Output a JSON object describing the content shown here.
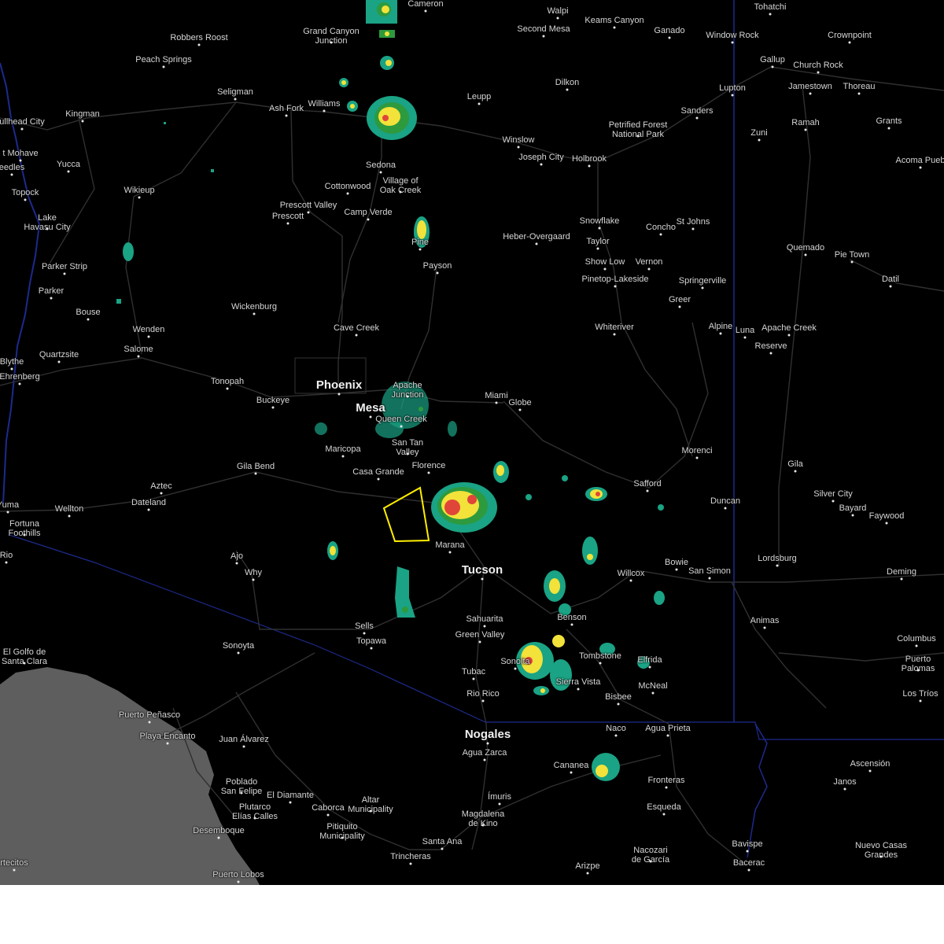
{
  "map": {
    "colors": {
      "background": "#000000",
      "mexico_land": "#050505",
      "ocean": "#5e5e5e",
      "road": "#2f2f2f",
      "border": "#1d2a8c",
      "warning_polygon": "#ffee00",
      "radar_light": "#1aa384",
      "radar_mid": "#2e9a3e",
      "radar_heavy": "#f2e23a",
      "radar_intense": "#e0453a"
    },
    "cities": [
      {
        "id": "cameron",
        "label": "Cameron"
      },
      {
        "id": "walpi",
        "label": "Walpi"
      },
      {
        "id": "second-mesa",
        "label": "Second Mesa"
      },
      {
        "id": "keams-canyon",
        "label": "Keams Canyon"
      },
      {
        "id": "tohatchi",
        "label": "Tohatchi"
      },
      {
        "id": "ganado",
        "label": "Ganado"
      },
      {
        "id": "window-rock",
        "label": "Window Rock"
      },
      {
        "id": "crownpoint",
        "label": "Crownpoint"
      },
      {
        "id": "robbers-roost",
        "label": "Robbers Roost"
      },
      {
        "id": "grand-canyon-junction",
        "label": "Grand Canyon Junction"
      },
      {
        "id": "peach-springs",
        "label": "Peach Springs"
      },
      {
        "id": "gallup",
        "label": "Gallup"
      },
      {
        "id": "church-rock",
        "label": "Church Rock"
      },
      {
        "id": "dilkon",
        "label": "Dilkon"
      },
      {
        "id": "lupton",
        "label": "Lupton"
      },
      {
        "id": "jamestown",
        "label": "Jamestown"
      },
      {
        "id": "thoreau",
        "label": "Thoreau"
      },
      {
        "id": "seligman",
        "label": "Seligman"
      },
      {
        "id": "bullhead-city",
        "label": "ullhead City"
      },
      {
        "id": "kingman",
        "label": "Kingman"
      },
      {
        "id": "williams",
        "label": "Williams"
      },
      {
        "id": "ash-fork",
        "label": "Ash Fork"
      },
      {
        "id": "leupp",
        "label": "Leupp"
      },
      {
        "id": "sanders",
        "label": "Sanders"
      },
      {
        "id": "grants",
        "label": "Grants"
      },
      {
        "id": "ramah",
        "label": "Ramah"
      },
      {
        "id": "fort-mohave",
        "label": "t Mohave"
      },
      {
        "id": "petrified-forest",
        "label": "Petrified Forest National Park"
      },
      {
        "id": "zuni",
        "label": "Zuni"
      },
      {
        "id": "winslow",
        "label": "Winslow"
      },
      {
        "id": "needles",
        "label": "eedles"
      },
      {
        "id": "yucca",
        "label": "Yucca"
      },
      {
        "id": "joseph-city",
        "label": "Joseph City"
      },
      {
        "id": "holbrook",
        "label": "Holbrook"
      },
      {
        "id": "acoma-pueblo",
        "label": "Acoma Pueb"
      },
      {
        "id": "sedona",
        "label": "Sedona"
      },
      {
        "id": "village-of-oak-creek",
        "label": "Village of Oak Creek"
      },
      {
        "id": "cottonwood",
        "label": "Cottonwood"
      },
      {
        "id": "wikieup",
        "label": "Wikieup"
      },
      {
        "id": "topock",
        "label": "Topock"
      },
      {
        "id": "prescott-valley",
        "label": "Prescott Valley"
      },
      {
        "id": "prescott",
        "label": "Prescott"
      },
      {
        "id": "camp-verde",
        "label": "Camp Verde"
      },
      {
        "id": "snowflake",
        "label": "Snowflake"
      },
      {
        "id": "lake-havasu-city",
        "label": "Lake Havasu City"
      },
      {
        "id": "concho",
        "label": "Concho"
      },
      {
        "id": "st-johns",
        "label": "St Johns"
      },
      {
        "id": "heber-overgaard",
        "label": "Heber-Overgaard"
      },
      {
        "id": "pine",
        "label": "Pine"
      },
      {
        "id": "taylor",
        "label": "Taylor"
      },
      {
        "id": "quemado",
        "label": "Quemado"
      },
      {
        "id": "pie-town",
        "label": "Pie Town"
      },
      {
        "id": "show-low",
        "label": "Show Low"
      },
      {
        "id": "vernon",
        "label": "Vernon"
      },
      {
        "id": "payson",
        "label": "Payson"
      },
      {
        "id": "parker-strip",
        "label": "Parker Strip"
      },
      {
        "id": "pinetop-lakeside",
        "label": "Pinetop-Lakeside"
      },
      {
        "id": "springerville",
        "label": "Springerville"
      },
      {
        "id": "datil",
        "label": "Datil"
      },
      {
        "id": "parker",
        "label": "Parker"
      },
      {
        "id": "greer",
        "label": "Greer"
      },
      {
        "id": "wickenburg",
        "label": "Wickenburg"
      },
      {
        "id": "bouse",
        "label": "Bouse"
      },
      {
        "id": "whiteriver",
        "label": "Whiteriver"
      },
      {
        "id": "alpine",
        "label": "Alpine"
      },
      {
        "id": "luna",
        "label": "Luna"
      },
      {
        "id": "apache-creek",
        "label": "Apache Creek"
      },
      {
        "id": "cave-creek",
        "label": "Cave Creek"
      },
      {
        "id": "wenden",
        "label": "Wenden"
      },
      {
        "id": "salome",
        "label": "Salome"
      },
      {
        "id": "reserve",
        "label": "Reserve"
      },
      {
        "id": "quartzsite",
        "label": "Quartzsite"
      },
      {
        "id": "blythe",
        "label": "Blythe"
      },
      {
        "id": "ehrenberg",
        "label": "Ehrenberg"
      },
      {
        "id": "tonopah",
        "label": "Tonopah"
      },
      {
        "id": "phoenix",
        "label": "Phoenix",
        "big": true
      },
      {
        "id": "apache-junction",
        "label": "Apache Junction"
      },
      {
        "id": "buckeye",
        "label": "Buckeye"
      },
      {
        "id": "miami",
        "label": "Miami"
      },
      {
        "id": "globe",
        "label": "Globe"
      },
      {
        "id": "mesa",
        "label": "Mesa",
        "big": true
      },
      {
        "id": "queen-creek",
        "label": "Queen Creek"
      },
      {
        "id": "san-tan-valley",
        "label": "San Tan Valley"
      },
      {
        "id": "maricopa",
        "label": "Maricopa"
      },
      {
        "id": "morenci",
        "label": "Morenci"
      },
      {
        "id": "florence",
        "label": "Florence"
      },
      {
        "id": "gila-bend",
        "label": "Gila Bend"
      },
      {
        "id": "gila",
        "label": "Gila"
      },
      {
        "id": "casa-grande",
        "label": "Casa Grande"
      },
      {
        "id": "safford",
        "label": "Safford"
      },
      {
        "id": "aztec",
        "label": "Aztec"
      },
      {
        "id": "silver-city",
        "label": "Silver City"
      },
      {
        "id": "duncan",
        "label": "Duncan"
      },
      {
        "id": "dateland",
        "label": "Dateland"
      },
      {
        "id": "bayard",
        "label": "Bayard"
      },
      {
        "id": "yuma",
        "label": "Yuma"
      },
      {
        "id": "wellton",
        "label": "Wellton"
      },
      {
        "id": "faywood",
        "label": "Faywood"
      },
      {
        "id": "fortuna-foothills",
        "label": "Fortuna Foothills"
      },
      {
        "id": "marana",
        "label": "Marana"
      },
      {
        "id": "lordsburg",
        "label": "Lordsburg"
      },
      {
        "id": "rio",
        "label": "Rio"
      },
      {
        "id": "ajo",
        "label": "Ajo"
      },
      {
        "id": "bowie",
        "label": "Bowie"
      },
      {
        "id": "tucson",
        "label": "Tucson",
        "big": true
      },
      {
        "id": "why",
        "label": "Why"
      },
      {
        "id": "san-simon",
        "label": "San Simon"
      },
      {
        "id": "willcox",
        "label": "Willcox"
      },
      {
        "id": "deming",
        "label": "Deming"
      },
      {
        "id": "benson",
        "label": "Benson"
      },
      {
        "id": "sahuarita",
        "label": "Sahuarita"
      },
      {
        "id": "animas",
        "label": "Animas"
      },
      {
        "id": "sells",
        "label": "Sells"
      },
      {
        "id": "green-valley",
        "label": "Green Valley"
      },
      {
        "id": "topawa",
        "label": "Topawa"
      },
      {
        "id": "columbus",
        "label": "Columbus"
      },
      {
        "id": "sonoyta",
        "label": "Sonoyta"
      },
      {
        "id": "el-golfo",
        "label": "El Golfo de Santa Clara"
      },
      {
        "id": "tombstone",
        "label": "Tombstone"
      },
      {
        "id": "elfrida",
        "label": "Elfrida"
      },
      {
        "id": "puerto-palomas",
        "label": "Puerto Palomas"
      },
      {
        "id": "sierra-vista",
        "label": "Sierra Vista"
      },
      {
        "id": "mcneal",
        "label": "McNeal"
      },
      {
        "id": "tubac",
        "label": "Tubac"
      },
      {
        "id": "rio-rico",
        "label": "Rio Rico"
      },
      {
        "id": "los-trios",
        "label": "Los Tríos"
      },
      {
        "id": "bisbee",
        "label": "Bisbee"
      },
      {
        "id": "sonoita",
        "label": "Sonoita"
      },
      {
        "id": "puerto-penasco",
        "label": "Puerto Peñasco"
      },
      {
        "id": "playa-encanto",
        "label": "Playa Encanto"
      },
      {
        "id": "naco",
        "label": "Naco"
      },
      {
        "id": "agua-prieta",
        "label": "Agua Prieta"
      },
      {
        "id": "nogales",
        "label": "Nogales",
        "big": true
      },
      {
        "id": "juan-alvarez",
        "label": "Juan Álvarez"
      },
      {
        "id": "agua-zarca",
        "label": "Agua Zarca"
      },
      {
        "id": "cananea",
        "label": "Cananea"
      },
      {
        "id": "ascension",
        "label": "Ascensión"
      },
      {
        "id": "janos",
        "label": "Janos"
      },
      {
        "id": "fronteras",
        "label": "Fronteras"
      },
      {
        "id": "poblado-san-felipe",
        "label": "Poblado San Felipe"
      },
      {
        "id": "el-diamante",
        "label": "El Diamante"
      },
      {
        "id": "imuris",
        "label": "Ímuris"
      },
      {
        "id": "altar",
        "label": "Altar Municipality"
      },
      {
        "id": "plutarco-elias-calles",
        "label": "Plutarco Elías Calles"
      },
      {
        "id": "caborca",
        "label": "Caborca"
      },
      {
        "id": "esqueda",
        "label": "Esqueda"
      },
      {
        "id": "magdalena-de-kino",
        "label": "Magdalena de Kino"
      },
      {
        "id": "pitiquito",
        "label": "Pitiquito Municipality"
      },
      {
        "id": "desemboque",
        "label": "Desemboque"
      },
      {
        "id": "santa-ana",
        "label": "Santa Ana"
      },
      {
        "id": "nacozari",
        "label": "Nacozari de García"
      },
      {
        "id": "bavispe",
        "label": "Bavispe"
      },
      {
        "id": "nuevo-casas-grandes",
        "label": "Nuevo Casas Grandes"
      },
      {
        "id": "trincheras",
        "label": "Trincheras"
      },
      {
        "id": "bacerac",
        "label": "Bacerac"
      },
      {
        "id": "puertecitos",
        "label": "rtecitos"
      },
      {
        "id": "arizpe",
        "label": "Arizpe"
      },
      {
        "id": "puerto-lobos",
        "label": "Puerto Lobos"
      }
    ]
  }
}
